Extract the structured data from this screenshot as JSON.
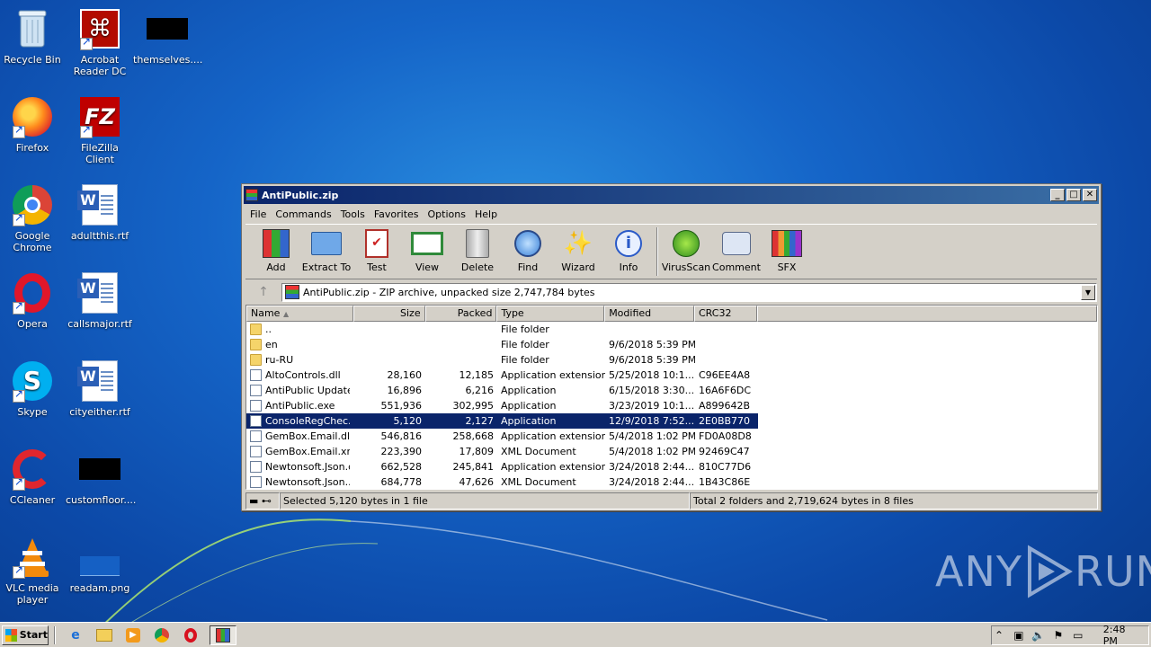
{
  "desktop": {
    "icons": [
      {
        "label": "Recycle Bin",
        "icon": "recycle-bin-icon"
      },
      {
        "label": "Acrobat Reader DC",
        "icon": "acrobat-icon"
      },
      {
        "label": "themselves....",
        "icon": "blacked-icon"
      },
      {
        "label": "Firefox",
        "icon": "firefox-icon"
      },
      {
        "label": "FileZilla Client",
        "icon": "filezilla-icon"
      },
      {
        "label": "Google Chrome",
        "icon": "chrome-icon"
      },
      {
        "label": "adultthis.rtf",
        "icon": "word-doc-icon"
      },
      {
        "label": "Opera",
        "icon": "opera-icon"
      },
      {
        "label": "callsmajor.rtf",
        "icon": "word-doc-icon"
      },
      {
        "label": "Skype",
        "icon": "skype-icon"
      },
      {
        "label": "cityeither.rtf",
        "icon": "word-doc-icon"
      },
      {
        "label": "CCleaner",
        "icon": "ccleaner-icon"
      },
      {
        "label": "customfloor....",
        "icon": "blacked-icon"
      },
      {
        "label": "VLC media player",
        "icon": "vlc-icon"
      },
      {
        "label": "readam.png",
        "icon": "image-icon"
      }
    ]
  },
  "window": {
    "title": "AntiPublic.zip",
    "menu": [
      "File",
      "Commands",
      "Tools",
      "Favorites",
      "Options",
      "Help"
    ],
    "toolbar": [
      "Add",
      "Extract To",
      "Test",
      "View",
      "Delete",
      "Find",
      "Wizard",
      "Info",
      "VirusScan",
      "Comment",
      "SFX"
    ],
    "address": "AntiPublic.zip - ZIP archive, unpacked size 2,747,784 bytes",
    "columns": {
      "name": "Name",
      "size": "Size",
      "packed": "Packed",
      "type": "Type",
      "modified": "Modified",
      "crc": "CRC32"
    },
    "files": [
      {
        "name": "..",
        "size": "",
        "packed": "",
        "type": "File folder",
        "modified": "",
        "crc": "",
        "kind": "folder"
      },
      {
        "name": "en",
        "size": "",
        "packed": "",
        "type": "File folder",
        "modified": "9/6/2018 5:39 PM",
        "crc": "",
        "kind": "folder"
      },
      {
        "name": "ru-RU",
        "size": "",
        "packed": "",
        "type": "File folder",
        "modified": "9/6/2018 5:39 PM",
        "crc": "",
        "kind": "folder"
      },
      {
        "name": "AltoControls.dll",
        "size": "28,160",
        "packed": "12,185",
        "type": "Application extension",
        "modified": "5/25/2018 10:1...",
        "crc": "C96EE4A8",
        "kind": "file"
      },
      {
        "name": "AntiPublic Update...",
        "size": "16,896",
        "packed": "6,216",
        "type": "Application",
        "modified": "6/15/2018 3:30...",
        "crc": "16A6F6DC",
        "kind": "file"
      },
      {
        "name": "AntiPublic.exe",
        "size": "551,936",
        "packed": "302,995",
        "type": "Application",
        "modified": "3/23/2019 10:1...",
        "crc": "A899642B",
        "kind": "file"
      },
      {
        "name": "ConsoleRegChec...",
        "size": "5,120",
        "packed": "2,127",
        "type": "Application",
        "modified": "12/9/2018 7:52...",
        "crc": "2E0BB770",
        "kind": "file",
        "selected": true
      },
      {
        "name": "GemBox.Email.dll",
        "size": "546,816",
        "packed": "258,668",
        "type": "Application extension",
        "modified": "5/4/2018 1:02 PM",
        "crc": "FD0A08D8",
        "kind": "file"
      },
      {
        "name": "GemBox.Email.xml",
        "size": "223,390",
        "packed": "17,809",
        "type": "XML Document",
        "modified": "5/4/2018 1:02 PM",
        "crc": "92469C47",
        "kind": "file"
      },
      {
        "name": "Newtonsoft.Json.dll",
        "size": "662,528",
        "packed": "245,841",
        "type": "Application extension",
        "modified": "3/24/2018 2:44...",
        "crc": "810C77D6",
        "kind": "file"
      },
      {
        "name": "Newtonsoft.Json...",
        "size": "684,778",
        "packed": "47,626",
        "type": "XML Document",
        "modified": "3/24/2018 2:44...",
        "crc": "1B43C86E",
        "kind": "file"
      }
    ],
    "status_left": "Selected 5,120 bytes in 1 file",
    "status_right": "Total 2 folders and 2,719,624 bytes in 8 files"
  },
  "taskbar": {
    "start": "Start",
    "clock": "2:48 PM"
  },
  "watermark": {
    "left": "ANY",
    "right": "RUN"
  }
}
